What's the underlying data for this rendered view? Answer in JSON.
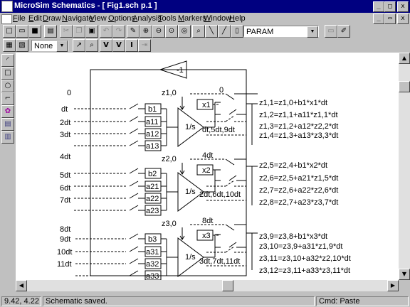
{
  "window": {
    "title": "MicroSim Schematics - [ Fig1.sch  p.1 ]"
  },
  "menu": [
    "File",
    "Edit",
    "Draw",
    "Navigate",
    "View",
    "Options",
    "Analysis",
    "Tools",
    "Markers",
    "Window",
    "Help"
  ],
  "toolbar": {
    "part_combo": "PARAM",
    "attr_combo": "None"
  },
  "schematic": {
    "gain_label": "-1",
    "integrator_label": "1/s",
    "rows": [
      {
        "input_times": [
          "0",
          "dt",
          "2dt",
          "3dt"
        ],
        "ic_label": "z1,0",
        "out_time_top": "0",
        "coef": [
          "b1",
          "a11",
          "a12",
          "a13"
        ],
        "out_gain": "x1",
        "switch_times": "dt,5dt,9dt",
        "eqs": [
          "z1,1=z1,0+b1*x1*dt",
          "z1,2=z1,1+a11*z1,1*dt",
          "z1,3=z1,2+a12*z2,2*dt",
          "z1,4=z1,3+a13*z3,3*dt"
        ]
      },
      {
        "input_times": [
          "4dt",
          "5dt",
          "6dt",
          "7dt"
        ],
        "ic_label": "z2,0",
        "out_time_top": "4dt",
        "coef": [
          "b2",
          "a21",
          "a22",
          "a23"
        ],
        "out_gain": "x2",
        "switch_times": "2dt,6dt,10dt",
        "eqs": [
          "z2,5=z2,4+b1*x2*dt",
          "z2,6=z2,5+a21*z1,5*dt",
          "z2,7=z2,6+a22*z2,6*dt",
          "z2,8=z2,7+a23*z3,7*dt"
        ]
      },
      {
        "input_times": [
          "8dt",
          "9dt",
          "10dt",
          "11dt"
        ],
        "ic_label": "z3,0",
        "out_time_top": "8dt",
        "coef": [
          "b3",
          "a31",
          "a32",
          "a33"
        ],
        "out_gain": "x3",
        "switch_times": "3dt,7dt,11dt",
        "eqs": [
          "z3,9=z3,8+b1*x3*dt",
          "z3,10=z3,9+a31*z1,9*dt",
          "z3,11=z3,10+a32*z2,10*dt",
          "z3,12=z3,11+a33*z3,11*dt"
        ]
      }
    ]
  },
  "status": {
    "coords": "9.42,  4.22",
    "message": "Schematic saved.",
    "command": "Cmd: Paste"
  }
}
